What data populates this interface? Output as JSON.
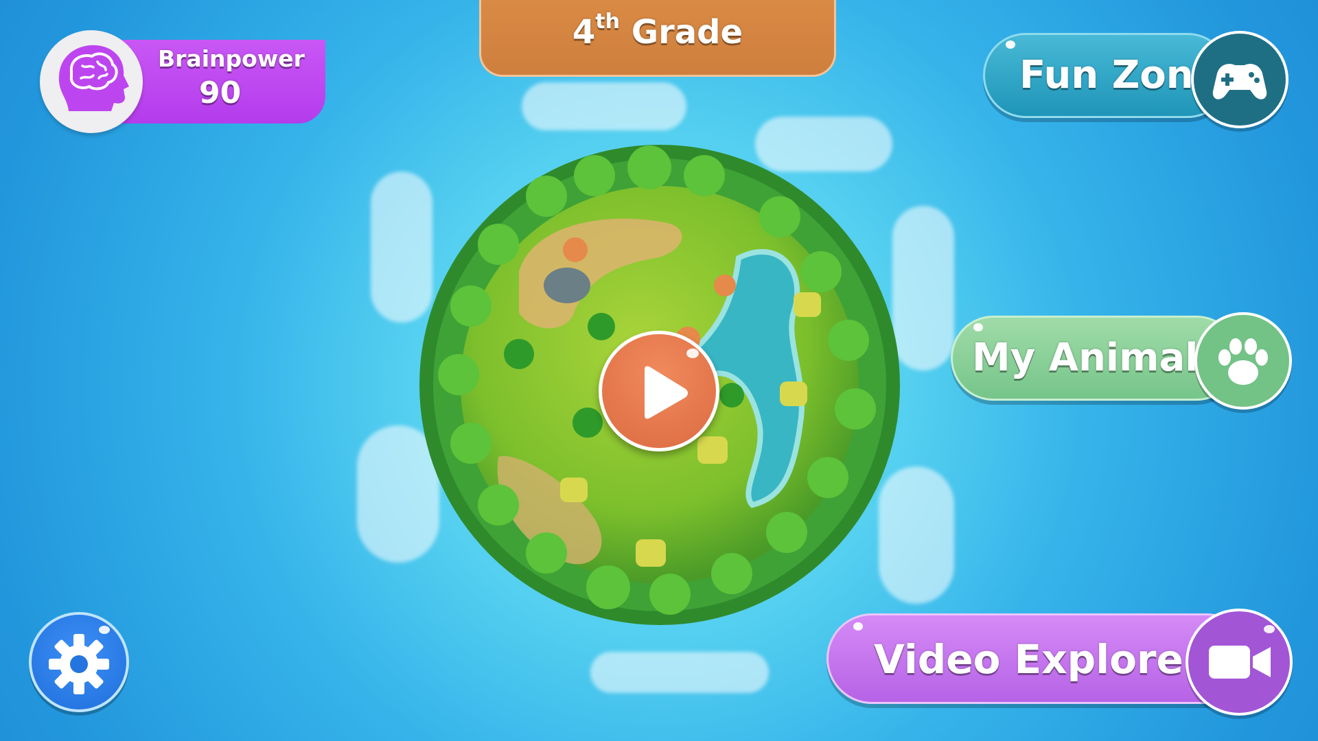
{
  "header": {
    "grade_number": "4",
    "grade_suffix": "th",
    "grade_word": "Grade"
  },
  "brainpower": {
    "label": "Brainpower",
    "value": "90",
    "icon": "brain-head-icon",
    "color": "#bd45ef"
  },
  "menu": {
    "fun_zone": {
      "label": "Fun Zone",
      "icon": "gamepad-icon",
      "color": "#2da6c8"
    },
    "my_animals": {
      "label": "My Animals",
      "icon": "paw-icon",
      "color": "#86cf97"
    },
    "video_explorer": {
      "label": "Video Explorer",
      "icon": "video-camera-icon",
      "color": "#c572ee"
    }
  },
  "planet": {
    "icon": "island-planet-icon"
  },
  "play": {
    "icon": "play-icon",
    "color": "#e2734a"
  },
  "settings": {
    "icon": "gear-icon",
    "color": "#2a7ae6"
  }
}
